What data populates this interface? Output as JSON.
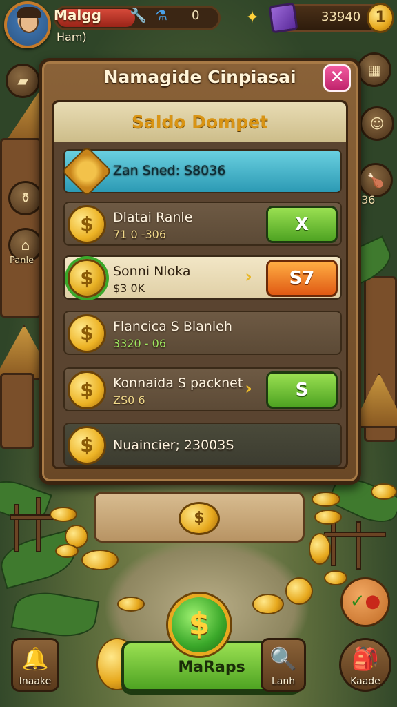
{
  "hud": {
    "player_name": "Malgg",
    "player_sub": "Ham)",
    "health_value": "0",
    "health_fraction": 0.48,
    "gold_value": "33940"
  },
  "side": {
    "right_badge": "36",
    "left_label": "Panle"
  },
  "panel": {
    "title": "Namagide Cinpiasai",
    "close_label": "✕",
    "section_title": "Saldo Dompet",
    "rows": [
      {
        "type": "teal",
        "single": "Zan Sned: S8036"
      },
      {
        "type": "normal",
        "name": "Dlatai Ranle",
        "value": "71 0 -306",
        "button": "X",
        "button_style": "green"
      },
      {
        "type": "highlight",
        "name": "Sonni Nloka",
        "value": "$3 0K",
        "button": "S7",
        "button_style": "orange",
        "arrow": "›"
      },
      {
        "type": "normal",
        "name": "Flancica S Blanleh",
        "value": "3320 - 06"
      },
      {
        "type": "normal",
        "name": "Konnaida S packnet",
        "value": "ZS0 6",
        "button": "S",
        "button_style": "green",
        "arrow": "›"
      },
      {
        "type": "normal",
        "single": "Nuaincier; 23003S"
      }
    ]
  },
  "bottom": {
    "main_button": "MaRaps",
    "left_corner": "Inaake",
    "middle_corner": "Lanh",
    "right_corner": "Kaade",
    "coin_symbol": "$"
  },
  "colors": {
    "accent_green": "#4ea322",
    "accent_orange": "#e05a14",
    "title_gold": "#d99414",
    "close_pink": "#c0246c"
  }
}
